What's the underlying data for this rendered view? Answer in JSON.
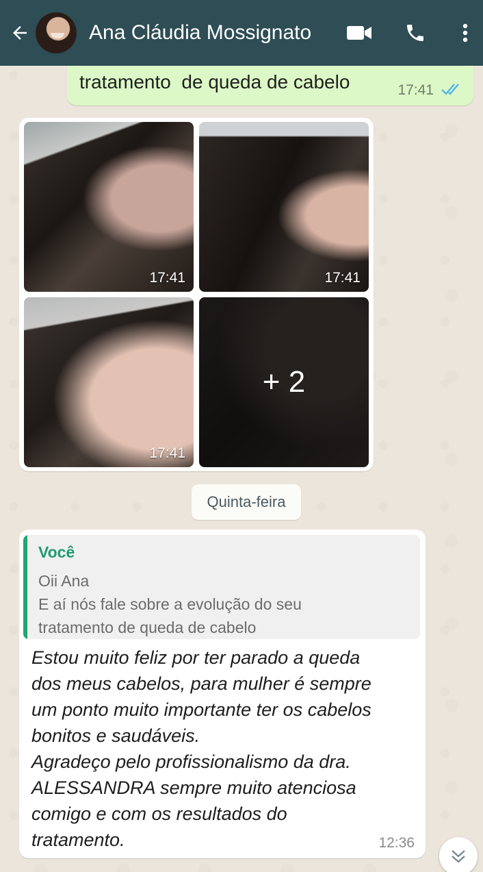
{
  "header": {
    "contact_name": "Ana Cláudia Mossignato",
    "icons": [
      "back-arrow-icon",
      "video-call-icon",
      "voice-call-icon",
      "more-options-icon"
    ]
  },
  "messages": {
    "outgoing_tail": {
      "text": "tratamento  de queda de cabelo",
      "time": "17:41",
      "status": "read"
    },
    "media_album": {
      "tiles": [
        {
          "time": "17:41"
        },
        {
          "time": "17:41"
        },
        {
          "time": "17:41"
        }
      ],
      "more_label": "+ 2"
    },
    "day_divider": "Quinta-feira",
    "incoming": {
      "quote_author": "Você",
      "quote_lines": [
        "Oii Ana",
        "E aí nós fale sobre a evolução do seu",
        "tratamento  de queda de cabelo"
      ],
      "text_lines": [
        "Estou muito feliz por ter parado a queda",
        "dos meus cabelos, para mulher é sempre",
        "um ponto muito importante ter os cabelos",
        "bonitos e saudáveis.",
        "Agradeço pelo profissionalismo da dra.",
        "ALESSANDRA sempre muito atenciosa",
        "comigo e com os resultados do",
        "tratamento."
      ],
      "time": "12:36"
    }
  },
  "colors": {
    "header_bg": "#2e4d55",
    "outgoing_bubble": "#dcf8c6",
    "quote_accent": "#1fa675",
    "read_ticks": "#4fb6ec"
  }
}
